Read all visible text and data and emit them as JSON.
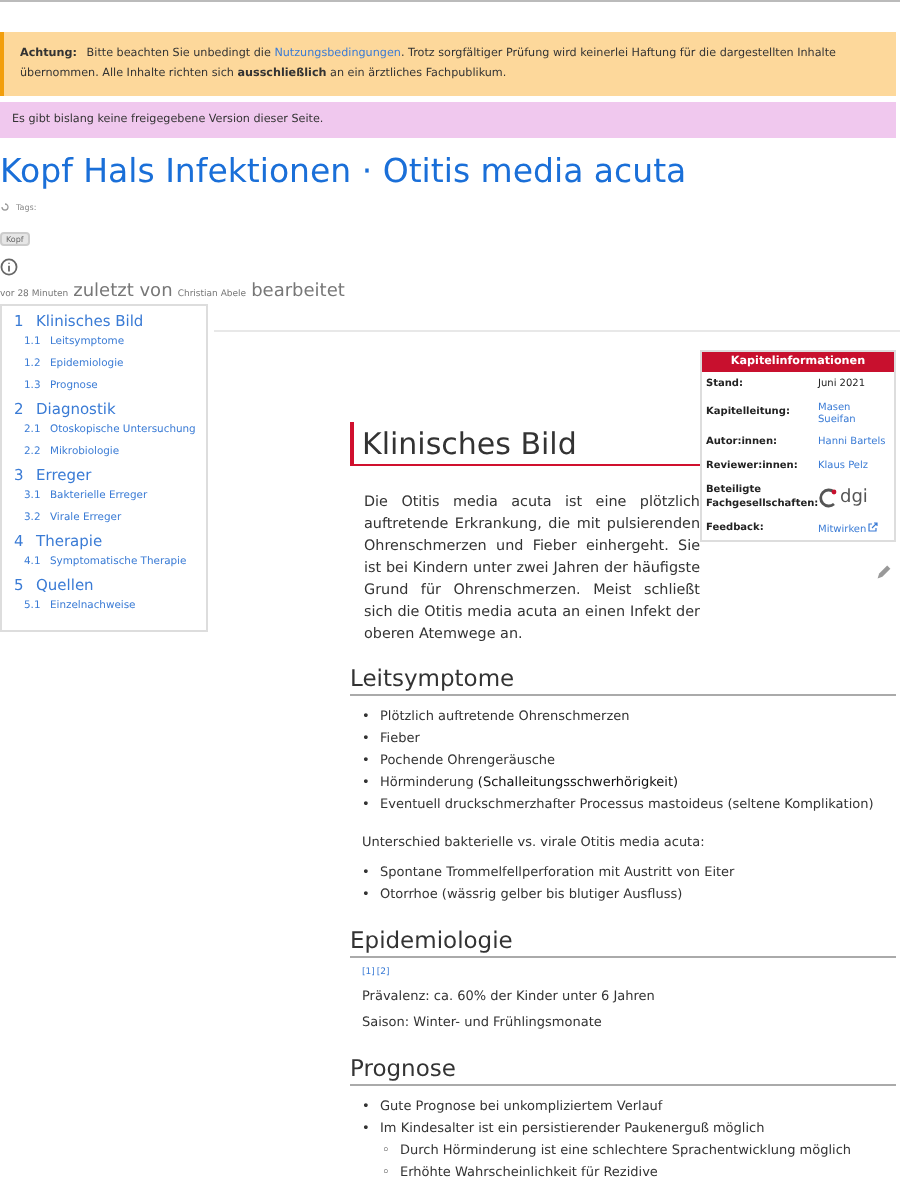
{
  "warning": {
    "label": "Achtung:",
    "before": "Bitte beachten Sie unbedingt die ",
    "link": "Nutzungsbedingungen",
    "after": ". Trotz sorgfältiger Prüfung wird keinerlei Haftung für die dargestellten Inhalte übernommen. Alle Inhalte richten sich **ausschließlich** an ein ärztliches Fachpublikum."
  },
  "notice": "Es gibt bislang keine freigegebene Version dieser Seite.",
  "title": "Kopf Hals Infektionen · Otitis media acuta",
  "tags": {
    "label": "Tags:",
    "items": [
      "Kopf"
    ]
  },
  "last_edit": {
    "time": "vor 28 Minuten",
    "middle": "zuletzt von",
    "author": "Christian Abele",
    "end": "bearbeitet"
  },
  "toc": [
    {
      "number": "1",
      "label": "Klinisches Bild",
      "children": [
        {
          "number": "1.1",
          "label": "Leitsymptome"
        },
        {
          "number": "1.2",
          "label": "Epidemiologie"
        },
        {
          "number": "1.3",
          "label": "Prognose"
        }
      ]
    },
    {
      "number": "2",
      "label": "Diagnostik",
      "children": [
        {
          "number": "2.1",
          "label": "Otoskopische Untersuchung"
        },
        {
          "number": "2.2",
          "label": "Mikrobiologie"
        }
      ]
    },
    {
      "number": "3",
      "label": "Erreger",
      "children": [
        {
          "number": "3.1",
          "label": "Bakterielle Erreger"
        },
        {
          "number": "3.2",
          "label": "Virale Erreger"
        }
      ]
    },
    {
      "number": "4",
      "label": "Therapie",
      "children": [
        {
          "number": "4.1",
          "label": "Symptomatische Therapie"
        }
      ]
    },
    {
      "number": "5",
      "label": "Quellen",
      "children": [
        {
          "number": "5.1",
          "label": "Einzelnachweise"
        }
      ]
    }
  ],
  "infobox": {
    "title": "Kapitelinformationen",
    "rows": [
      {
        "label": "Stand:",
        "kind": "text",
        "value": "Juni 2021"
      },
      {
        "label": "Kapitelleitung:",
        "kind": "link",
        "value": "Masen Sueifan"
      },
      {
        "label": "Autor:innen:",
        "kind": "link",
        "value": "Hanni Bartels"
      },
      {
        "label": "Reviewer:innen:",
        "kind": "link",
        "value": "Klaus Pelz"
      },
      {
        "label": "Beteiligte Fachgesellschaften:",
        "kind": "logo",
        "value": "dgi"
      },
      {
        "label": "Feedback:",
        "kind": "external",
        "value": "Mitwirken"
      }
    ]
  },
  "sections": [
    {
      "kind": "h1",
      "heading": "Klinisches Bild",
      "blocks": [
        {
          "kind": "paragraph",
          "text": "Die Otitis media acuta ist eine plötzlich auftretende Erkrankung, die mit pulsierenden Ohrenschmerzen und Fieber einhergeht. Sie ist bei Kindern unter zwei Jahren der häufigste Grund für Ohrenschmerzen. Meist schließt sich die Otitis media acuta an einen Infekt der oberen Atemwege an."
        }
      ]
    },
    {
      "kind": "h2",
      "heading": "Leitsymptome",
      "blocks": [
        {
          "kind": "list",
          "items": [
            {
              "marker": "•",
              "text": "Plötzlich auftretende Ohrenschmerzen"
            },
            {
              "marker": "•",
              "text": "Fieber"
            },
            {
              "marker": "•",
              "text": "Pochende Ohrengeräusche"
            },
            {
              "marker": "•",
              "text": "Hörminderung ",
              "term": "(Schalleitungsschwerhörigkeit)"
            },
            {
              "marker": "•",
              "text": "Eventuell druckschmerzhafter Processus mastoideus (seltene Komplikation)"
            }
          ]
        },
        {
          "kind": "paragraph",
          "text": "Unterschied bakterielle vs. virale Otitis media acuta:"
        },
        {
          "kind": "list",
          "items": [
            {
              "marker": "•",
              "text": "Spontane Trommelfellperforation mit Austritt von Eiter"
            },
            {
              "marker": "•",
              "text": "Otorrhoe (wässrig gelber bis blutiger Ausfluss)"
            }
          ]
        }
      ]
    },
    {
      "kind": "h2",
      "heading": "Epidemiologie",
      "blocks": [
        {
          "kind": "refs",
          "items": [
            "[1]",
            "[2]"
          ]
        },
        {
          "kind": "line",
          "text": "Prävalenz: ca. 60% der Kinder unter 6 Jahren"
        },
        {
          "kind": "line",
          "text": "Saison: Winter- und Frühlingsmonate"
        }
      ]
    },
    {
      "kind": "h2",
      "heading": "Prognose",
      "blocks": [
        {
          "kind": "list",
          "items": [
            {
              "marker": "•",
              "text": "Gute Prognose bei unkompliziertem Verlauf"
            },
            {
              "marker": "•",
              "text": "Im Kindesalter ist ein persistierender Paukenerguß möglich",
              "children": [
                {
                  "marker": "◦",
                  "text": "Durch Hörminderung ist eine schlechtere Sprachentwicklung möglich"
                },
                {
                  "marker": "◦",
                  "text": "Erhöhte Wahrscheinlichkeit für Rezidive"
                }
              ]
            }
          ]
        }
      ]
    }
  ]
}
